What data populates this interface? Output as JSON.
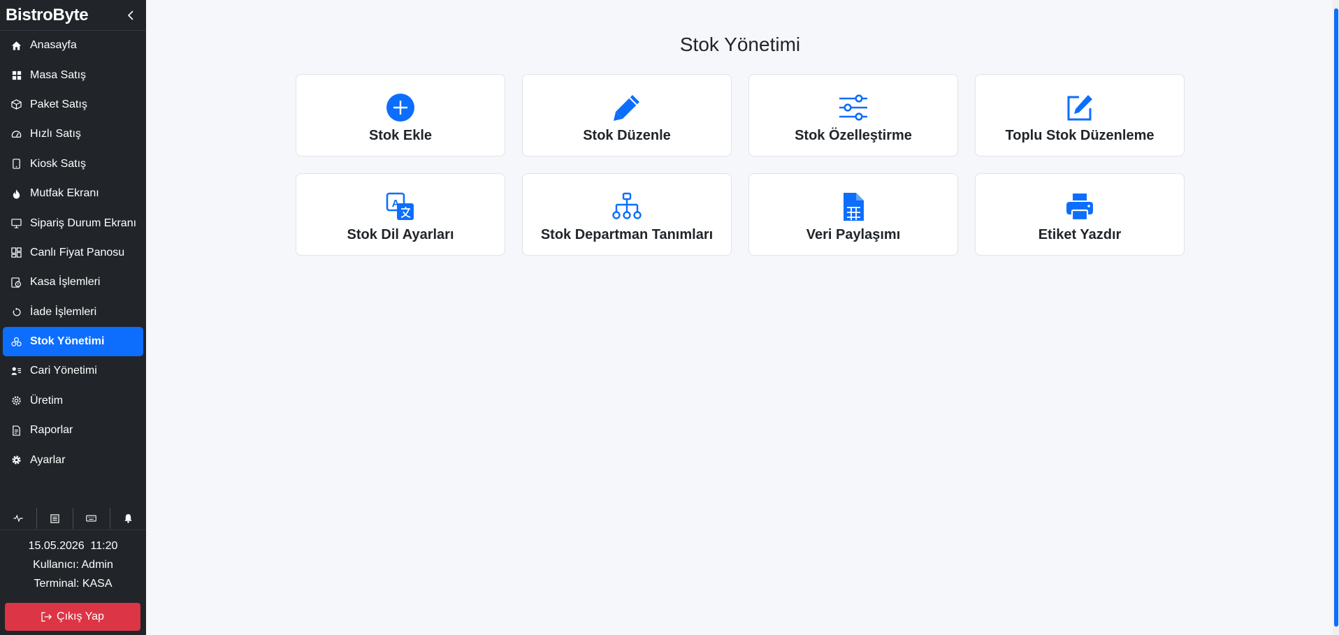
{
  "app": {
    "brand": "BistroByte"
  },
  "sidebar": {
    "items": [
      {
        "label": "Anasayfa",
        "icon": "home-icon"
      },
      {
        "label": "Masa Satış",
        "icon": "grid-icon"
      },
      {
        "label": "Paket Satış",
        "icon": "box-icon"
      },
      {
        "label": "Hızlı Satış",
        "icon": "speedometer-icon"
      },
      {
        "label": "Kiosk Satış",
        "icon": "tablet-icon"
      },
      {
        "label": "Mutfak Ekranı",
        "icon": "fire-icon"
      },
      {
        "label": "Sipariş Durum Ekranı",
        "icon": "monitor-icon"
      },
      {
        "label": "Canlı Fiyat Panosu",
        "icon": "dashboard-icon"
      },
      {
        "label": "Kasa İşlemleri",
        "icon": "cash-register-icon"
      },
      {
        "label": "İade İşlemleri",
        "icon": "refresh-icon"
      },
      {
        "label": "Stok Yönetimi",
        "icon": "boxes-icon",
        "active": true
      },
      {
        "label": "Cari Yönetimi",
        "icon": "person-lines-icon"
      },
      {
        "label": "Üretim",
        "icon": "gear-wide-icon"
      },
      {
        "label": "Raporlar",
        "icon": "file-text-icon"
      },
      {
        "label": "Ayarlar",
        "icon": "gear-icon"
      }
    ],
    "tools": [
      "activity-icon",
      "receipt-icon",
      "keyboard-icon",
      "bell-icon"
    ],
    "info": {
      "datetime": "15.05.2026  11:20",
      "user": "Kullanıcı: Admin",
      "terminal": "Terminal: KASA"
    },
    "logout_label": "Çıkış Yap"
  },
  "main": {
    "title": "Stok Yönetimi",
    "cards": [
      {
        "label": "Stok Ekle",
        "icon": "plus-circle-icon"
      },
      {
        "label": "Stok Düzenle",
        "icon": "pencil-icon"
      },
      {
        "label": "Stok Özelleştirme",
        "icon": "sliders-icon"
      },
      {
        "label": "Toplu Stok Düzenleme",
        "icon": "pencil-square-icon"
      },
      {
        "label": "Stok Dil Ayarları",
        "icon": "translate-icon"
      },
      {
        "label": "Stok Departman Tanımları",
        "icon": "diagram-icon"
      },
      {
        "label": "Veri Paylaşımı",
        "icon": "file-spreadsheet-icon"
      },
      {
        "label": "Etiket Yazdır",
        "icon": "printer-icon"
      }
    ]
  },
  "colors": {
    "sidebar_bg": "#212529",
    "accent": "#0d6efd",
    "danger": "#dc3545",
    "page_bg": "#f5f7fa"
  }
}
